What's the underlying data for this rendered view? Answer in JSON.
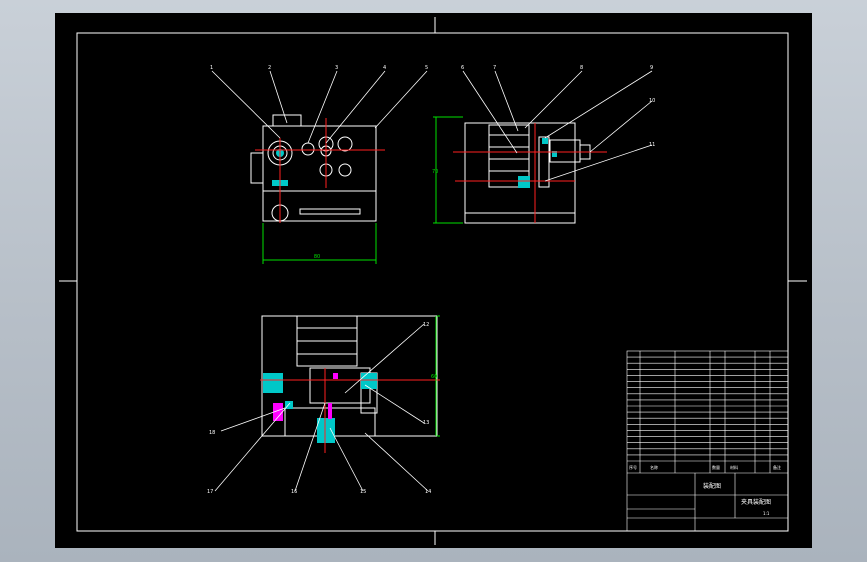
{
  "colors": {
    "background": "#000000",
    "frame": "#ffffff",
    "centerline": "#ff2020",
    "dimension": "#00e000",
    "hatch": "#00c8c8",
    "section_magenta": "#ff00ff",
    "outline": "#ffffff",
    "label": "#ffffff"
  },
  "callouts": {
    "top": [
      "1",
      "2",
      "3",
      "4",
      "5",
      "6",
      "7",
      "8",
      "9"
    ],
    "right": [
      "10",
      "11",
      "12",
      "13"
    ],
    "bottom": [
      "14",
      "15",
      "16",
      "17",
      "18"
    ]
  },
  "dimensions": {
    "front_width": "80",
    "side_height": "70",
    "plan_height": "60"
  },
  "title_block": {
    "part_title": "夹具装配图",
    "assembly_label": "装配图",
    "header_cols": [
      "序号",
      "名称",
      "数量",
      "材料",
      "备注"
    ],
    "scale": "1:1"
  }
}
